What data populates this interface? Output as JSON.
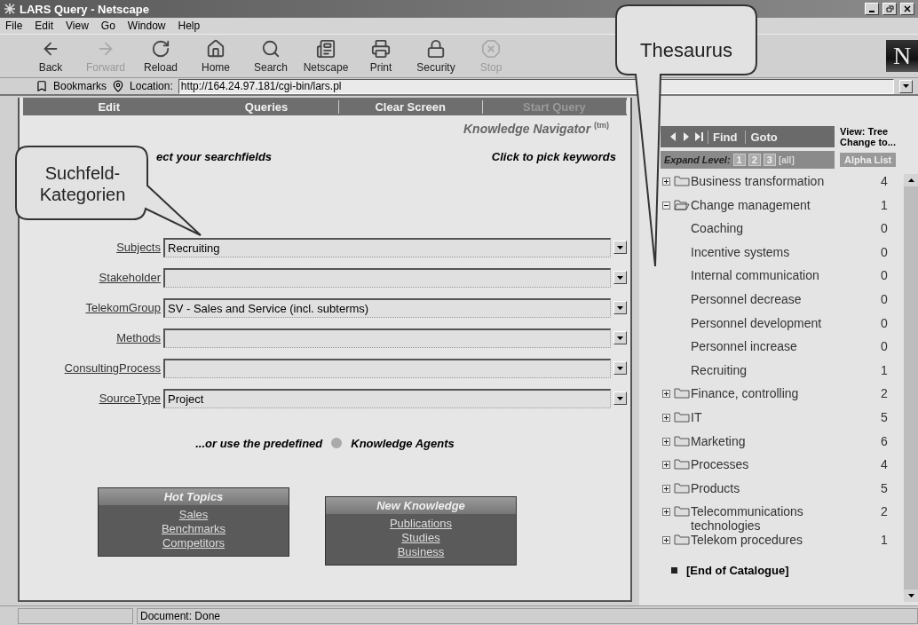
{
  "window": {
    "title": "LARS Query - Netscape"
  },
  "menu": [
    "File",
    "Edit",
    "View",
    "Go",
    "Window",
    "Help"
  ],
  "toolbar": [
    {
      "kind": "back",
      "label": "Back",
      "disabled": false
    },
    {
      "kind": "forward",
      "label": "Forward",
      "disabled": true
    },
    {
      "kind": "reload",
      "label": "Reload",
      "disabled": false
    },
    {
      "kind": "home",
      "label": "Home",
      "disabled": false
    },
    {
      "kind": "search",
      "label": "Search",
      "disabled": false
    },
    {
      "kind": "portal",
      "label": "Netscape",
      "disabled": false
    },
    {
      "kind": "print",
      "label": "Print",
      "disabled": false
    },
    {
      "kind": "security",
      "label": "Security",
      "disabled": false
    },
    {
      "kind": "stop",
      "label": "Stop",
      "disabled": true
    }
  ],
  "logo": "N",
  "location_bar": {
    "bookmarks": "Bookmarks",
    "label": "Location:",
    "value": "http://164.24.97.181/cgi-bin/lars.pl"
  },
  "query_frame": {
    "nav": [
      {
        "label": "Edit",
        "disabled": false
      },
      {
        "label": "Queries",
        "disabled": false
      },
      {
        "label": "Clear Screen",
        "disabled": false
      },
      {
        "label": "Start Query",
        "disabled": true
      }
    ],
    "brand": "Knowledge Navigator $^{(tm)}$",
    "prompt": "ect your searchfields",
    "pick_hint": "Click to pick keywords",
    "fields": [
      {
        "label": "Subjects",
        "value": "Recruiting"
      },
      {
        "label": "Stakeholder"
      },
      {
        "label": "TelekomGroup",
        "value": "SV - Sales and Service (incl. subterms)"
      },
      {
        "label": "Methods"
      },
      {
        "label": "ConsultingProcess"
      },
      {
        "label": "SourceType",
        "value": "Project"
      }
    ],
    "agents_intro": "...or use the predefined",
    "agents_title": "Knowledge Agents",
    "agents": [
      {
        "title": "Hot Topics",
        "links": [
          "Sales",
          "Benchmarks",
          "Competitors"
        ]
      },
      {
        "title": "New Knowledge",
        "links": [
          "Publications",
          "Studies",
          "Business"
        ]
      }
    ]
  },
  "thesaurus_frame": {
    "nav": [
      {
        "kind": "prev"
      },
      {
        "kind": "next"
      },
      {
        "kind": "last"
      },
      {
        "kind": "text",
        "label": "Find"
      },
      {
        "kind": "text",
        "label": "Goto"
      }
    ],
    "view": "View: Tree",
    "change": "Change to...",
    "expand_label": "Expand Level:",
    "levels": [
      "1",
      "2",
      "3",
      "[all]"
    ],
    "alpha": "Alpha List",
    "tree": [
      {
        "kind": "folder",
        "label": "Business transformation",
        "count": "4",
        "expanded": false
      },
      {
        "kind": "folder",
        "label": "Change management",
        "count": "1",
        "expanded": true,
        "children": [
          {
            "kind": "term",
            "label": "Coaching",
            "count": "0"
          },
          {
            "kind": "term",
            "label": "Incentive systems",
            "count": "0"
          },
          {
            "kind": "term",
            "label": "Internal communication",
            "count": "0"
          },
          {
            "kind": "term",
            "label": "Personnel decrease",
            "count": "0"
          },
          {
            "kind": "term",
            "label": "Personnel development",
            "count": "0"
          },
          {
            "kind": "term",
            "label": "Personnel increase",
            "count": "0"
          },
          {
            "kind": "term",
            "label": "Recruiting",
            "count": "1"
          }
        ]
      },
      {
        "kind": "folder",
        "label": "Finance, controlling",
        "count": "2",
        "expanded": false
      },
      {
        "kind": "folder",
        "label": "IT",
        "count": "5",
        "expanded": false
      },
      {
        "kind": "folder",
        "label": "Marketing",
        "count": "6",
        "expanded": false
      },
      {
        "kind": "folder",
        "label": "Processes",
        "count": "4",
        "expanded": false
      },
      {
        "kind": "folder",
        "label": "Products",
        "count": "5",
        "expanded": false
      },
      {
        "kind": "folder",
        "label": "Telecommunications technologies",
        "count": "2",
        "expanded": false
      },
      {
        "kind": "folder",
        "label": "Telekom procedures",
        "count": "1",
        "expanded": false
      }
    ],
    "end": "[End of Catalogue]"
  },
  "status_bar": "Document: Done",
  "callouts": [
    {
      "kind": "top",
      "text": "Thesaurus"
    },
    {
      "kind": "left",
      "text": "Suchfeld-Kategorien"
    }
  ]
}
